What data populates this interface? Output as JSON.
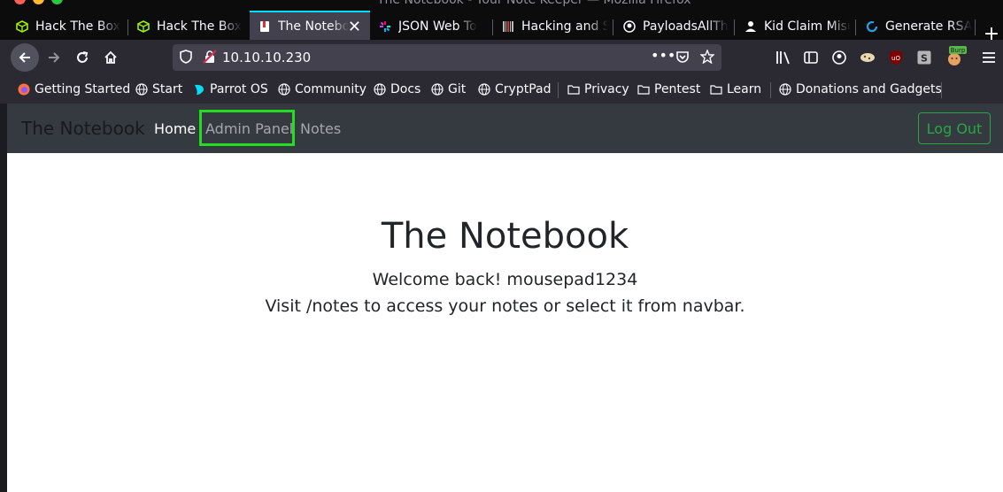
{
  "window": {
    "title": "The Notebook - Your Note Keeper — Mozilla Firefox"
  },
  "tabs": [
    {
      "label": "Hack The Box",
      "favicon": "htb-cube-icon",
      "active": false
    },
    {
      "label": "Hack The Box",
      "favicon": "htb-cube-icon",
      "active": false
    },
    {
      "label": "The Notebook",
      "favicon": "notebook-icon",
      "active": true
    },
    {
      "label": "JSON Web To",
      "favicon": "jwt-icon",
      "active": false
    },
    {
      "label": "Hacking and S",
      "favicon": "barcode-icon",
      "active": false
    },
    {
      "label": "PayloadsAllTh",
      "favicon": "github-icon",
      "active": false
    },
    {
      "label": "Kid Claim Misu",
      "favicon": "user-icon",
      "active": false
    },
    {
      "label": "Generate RSA",
      "favicon": "generate-icon",
      "active": false
    }
  ],
  "toolbar": {
    "url": "10.10.10.230",
    "burp_badge": "Burp"
  },
  "bookmarks": [
    {
      "label": "Getting Started",
      "icon": "firefox-icon"
    },
    {
      "label": "Start",
      "icon": "globe-icon"
    },
    {
      "label": "Parrot OS",
      "icon": "parrot-icon"
    },
    {
      "label": "Community",
      "icon": "globe-icon"
    },
    {
      "label": "Docs",
      "icon": "globe-icon"
    },
    {
      "label": "Git",
      "icon": "globe-icon"
    },
    {
      "label": "CryptPad",
      "icon": "globe-icon"
    },
    {
      "label": "Privacy",
      "icon": "folder-icon"
    },
    {
      "label": "Pentest",
      "icon": "folder-icon"
    },
    {
      "label": "Learn",
      "icon": "folder-icon"
    },
    {
      "label": "Donations and Gadgets",
      "icon": "globe-icon"
    }
  ],
  "site": {
    "brand": "The Notebook",
    "nav": {
      "home": "Home",
      "admin": "Admin Panel",
      "notes": "Notes"
    },
    "logout": "Log Out",
    "hero": {
      "title": "The Notebook",
      "welcome": "Welcome back! mousepad1234",
      "hint": "Visit /notes to access your notes or select it from navbar."
    },
    "colors": {
      "navbar_bg": "#343a40",
      "logout_accent": "#28a745",
      "highlight_box": "#22dd22"
    }
  }
}
